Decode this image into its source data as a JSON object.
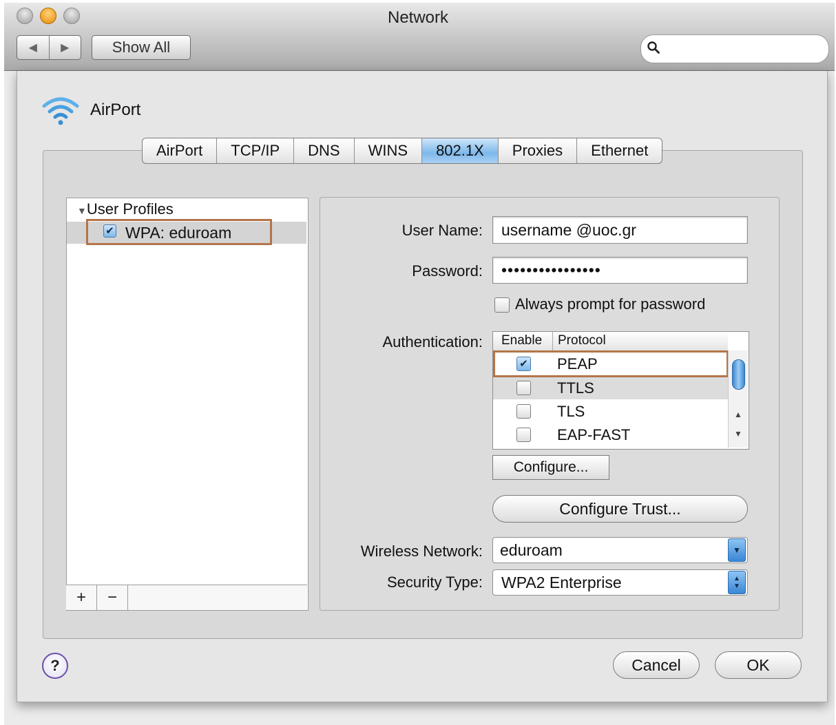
{
  "window": {
    "title": "Network",
    "show_all_label": "Show All",
    "search_placeholder": ""
  },
  "sheet": {
    "interface_label": "AirPort",
    "tabs": [
      "AirPort",
      "TCP/IP",
      "DNS",
      "WINS",
      "802.1X",
      "Proxies",
      "Ethernet"
    ],
    "active_tab": "802.1X",
    "profiles": {
      "header": "User Profiles",
      "items": [
        {
          "label": "WPA: eduroam",
          "checked": true
        }
      ],
      "add_label": "+",
      "remove_label": "−"
    },
    "form": {
      "username_label": "User Name:",
      "username_value": "username @uoc.gr",
      "password_label": "Password:",
      "password_value": "••••••••••••••••",
      "always_prompt_label": "Always prompt for password",
      "auth_label": "Authentication:",
      "auth_columns": [
        "Enable",
        "Protocol"
      ],
      "auth_rows": [
        {
          "name": "PEAP",
          "enabled": true
        },
        {
          "name": "TTLS",
          "enabled": false
        },
        {
          "name": "TLS",
          "enabled": false
        },
        {
          "name": "EAP-FAST",
          "enabled": false
        }
      ],
      "configure_label": "Configure...",
      "configure_trust_label": "Configure Trust...",
      "wireless_network_label": "Wireless Network:",
      "wireless_network_value": "eduroam",
      "security_type_label": "Security Type:",
      "security_type_value": "WPA2 Enterprise"
    },
    "buttons": {
      "help": "?",
      "cancel": "Cancel",
      "ok": "OK"
    }
  },
  "colors": {
    "highlight_box": "#b4744a",
    "active_tab": "#7db8ea"
  }
}
